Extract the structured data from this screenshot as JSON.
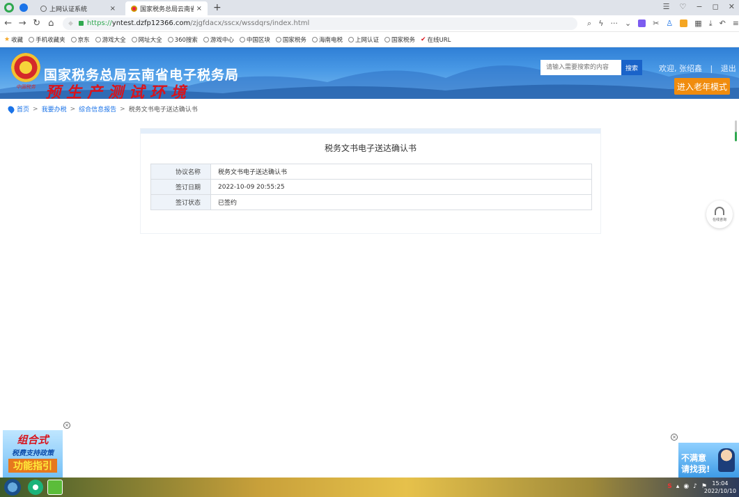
{
  "browser": {
    "tabs": [
      {
        "title": "上网认证系统",
        "active": false
      },
      {
        "title": "国家税务总局云南省电子税务局",
        "active": true
      }
    ],
    "url": {
      "scheme": "https://",
      "host": "yntest.dzfp12366.com",
      "path": "/zjgfdacx/sscx/wssdqrs/index.html"
    },
    "bookmarks": [
      "收藏",
      "手机收藏夹",
      "京东",
      "游戏大全",
      "网址大全",
      "360搜索",
      "游戏中心",
      "中国区块",
      "国家税务",
      "海南电税",
      "上网认证",
      "国家税务",
      "在线URL"
    ]
  },
  "header": {
    "emblem_caption": "中国税务",
    "title": "国家税务总局云南省电子税务局",
    "subtitle": "预生产测试环境",
    "search_placeholder": "请输入需要搜索的内容",
    "search_label": "搜索",
    "welcome_label": "欢迎,",
    "user_name": "张绍鑫",
    "logout_label": "退出",
    "elder_mode_label": "进入老年模式"
  },
  "breadcrumb": [
    "首页",
    "我要办税",
    "综合信息报告",
    "税务文书电子送达确认书"
  ],
  "card": {
    "title": "税务文书电子送达确认书",
    "rows": [
      {
        "label": "协议名称",
        "value": "税务文书电子送达确认书"
      },
      {
        "label": "签订日期",
        "value": "2022-10-09 20:55:25"
      },
      {
        "label": "签订状态",
        "value": "已签约"
      }
    ]
  },
  "widgets": {
    "online_consult_label": "在线咨询",
    "ad_left": [
      "组合式",
      "税费支持政策",
      "功能指引"
    ],
    "ad_right": [
      "不满意",
      "请找我!"
    ]
  },
  "taskbar": {
    "time": "15:04",
    "date": "2022/10/10"
  }
}
